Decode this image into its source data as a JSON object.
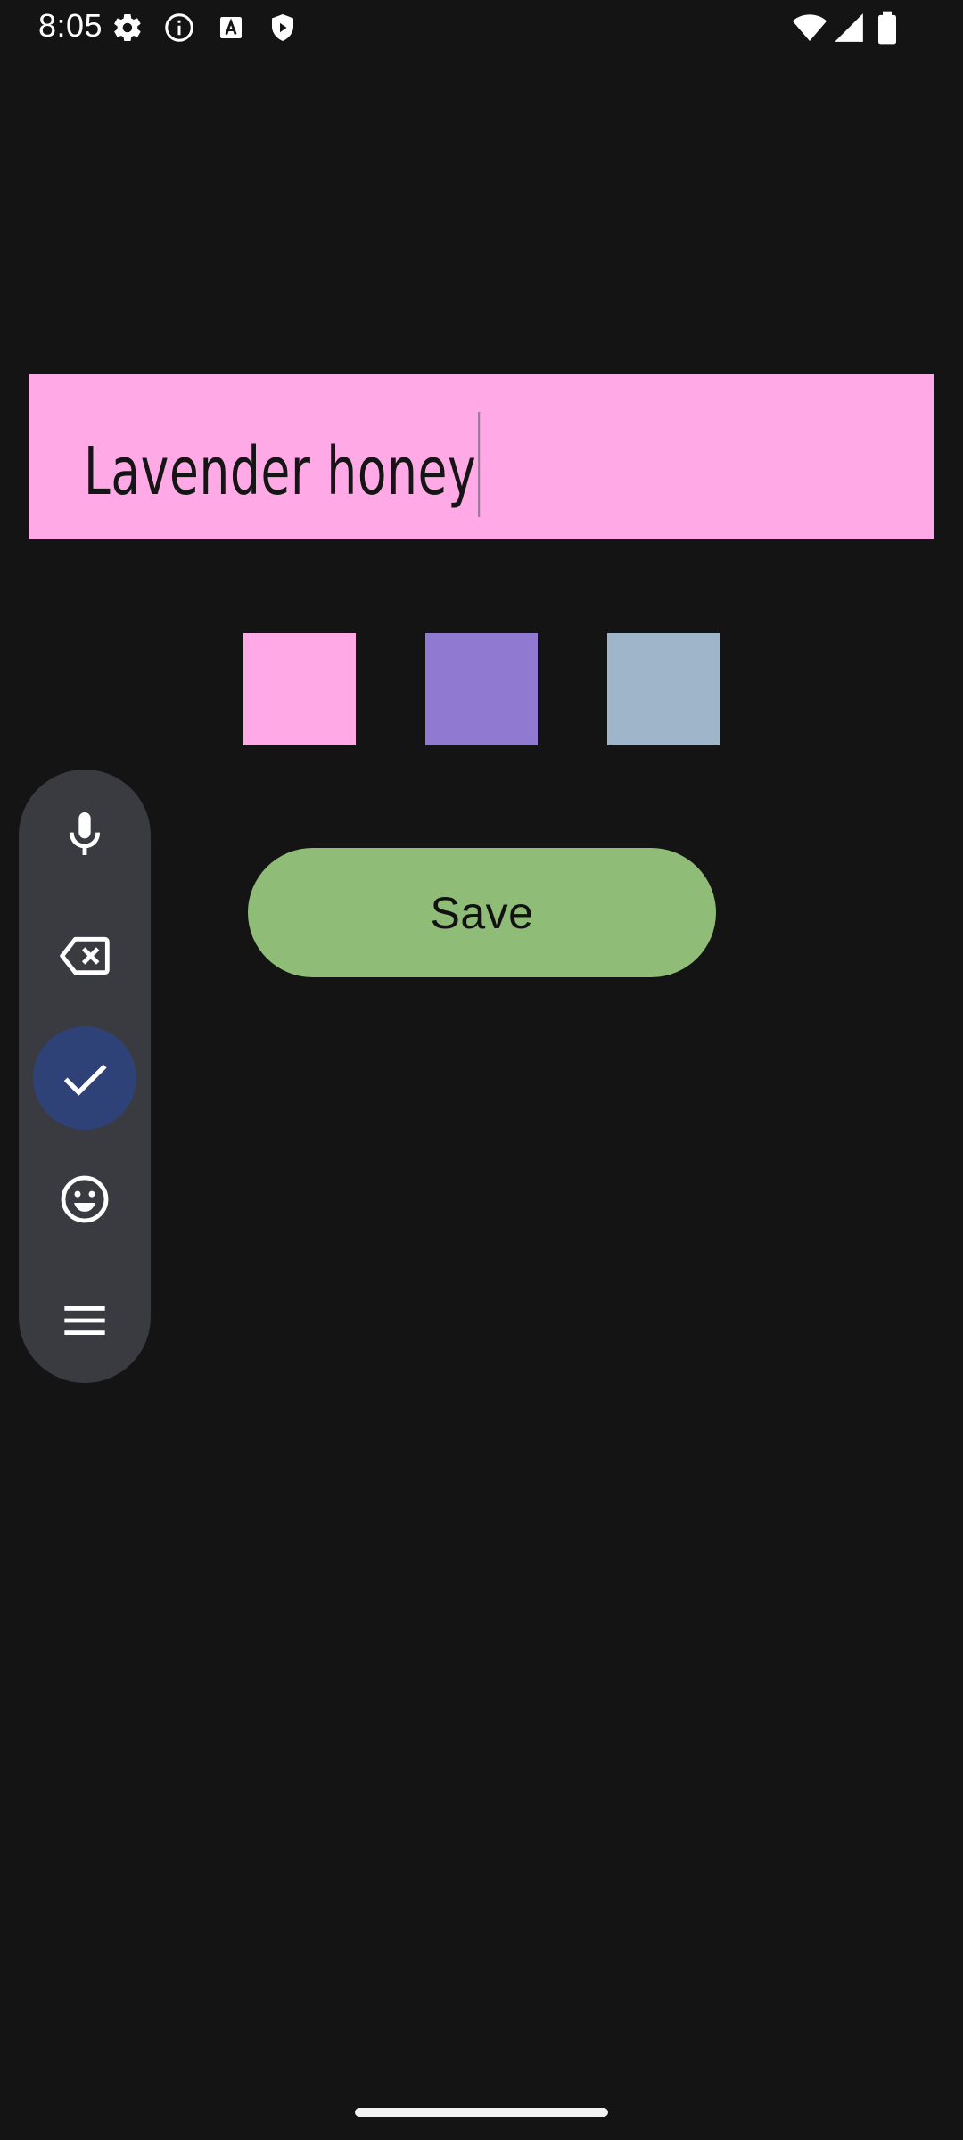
{
  "status_bar": {
    "time": "8:05",
    "left_icons": [
      "settings-gear-icon",
      "info-circle-icon",
      "font-a-icon",
      "shield-play-icon"
    ],
    "right_icons": [
      "wifi-icon",
      "cell-signal-icon",
      "battery-icon"
    ]
  },
  "note": {
    "text": "Lavender honey",
    "background_color": "#ffaae6"
  },
  "color_options": [
    {
      "name": "pink",
      "color": "#ffaae6"
    },
    {
      "name": "purple",
      "color": "#9079d1"
    },
    {
      "name": "blue-gray",
      "color": "#9fb6ca"
    }
  ],
  "save_button": {
    "label": "Save",
    "color": "#8fbc76"
  },
  "ime_toolbar": {
    "buttons": [
      "microphone-icon",
      "backspace-icon",
      "checkmark-icon",
      "emoji-icon",
      "menu-icon"
    ],
    "active_button": "checkmark-icon",
    "active_color": "#2f4277"
  }
}
